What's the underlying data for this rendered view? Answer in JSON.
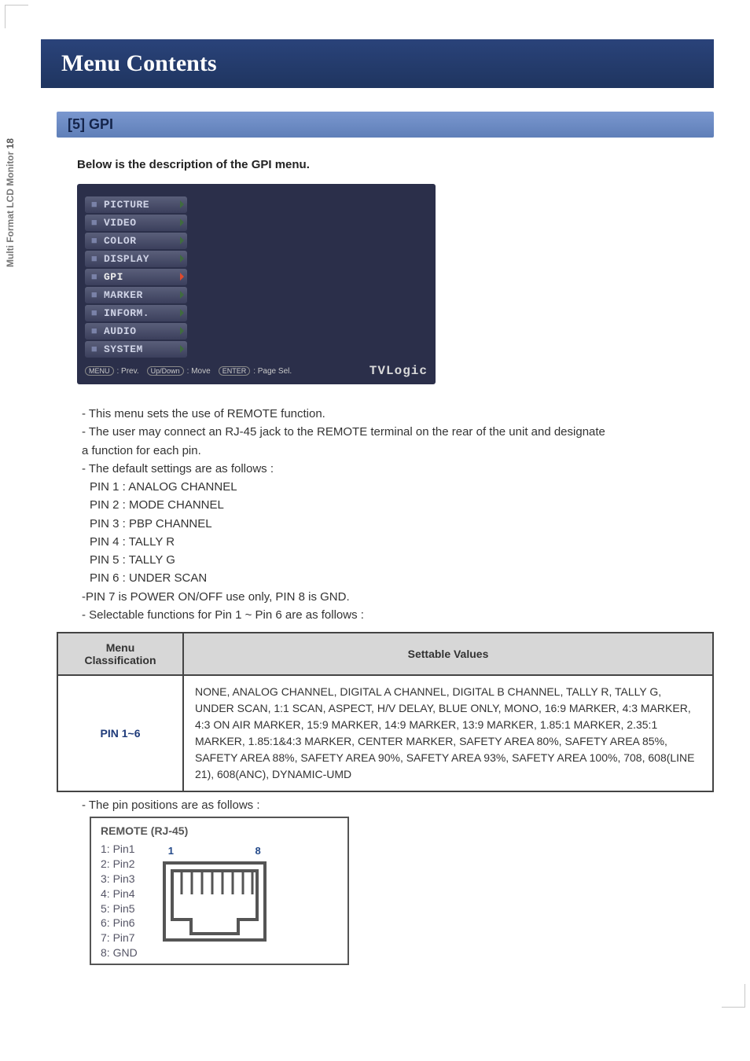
{
  "side_label_prefix": "Multi Format LCD Monitor ",
  "side_label_page": "18",
  "header_title": "Menu Contents",
  "section_header": "[5] GPI",
  "intro": "Below is the description of the GPI menu.",
  "osd": {
    "tabs": [
      {
        "label": "PICTURE",
        "selected": false
      },
      {
        "label": "VIDEO",
        "selected": false
      },
      {
        "label": "COLOR",
        "selected": false
      },
      {
        "label": "DISPLAY",
        "selected": false
      },
      {
        "label": "GPI",
        "selected": true
      },
      {
        "label": "MARKER",
        "selected": false
      },
      {
        "label": "INFORM.",
        "selected": false
      },
      {
        "label": "AUDIO",
        "selected": false
      },
      {
        "label": "SYSTEM",
        "selected": false
      }
    ],
    "hints": {
      "menu_btn": "MENU",
      "menu_txt": ": Prev.",
      "updown_btn": "Up/Down",
      "updown_txt": ": Move",
      "enter_btn": "ENTER",
      "enter_txt": ": Page Sel."
    },
    "logo": "TVLogic"
  },
  "desc_lines": {
    "l1": "- This menu sets the use of REMOTE function.",
    "l2a": "- The user may connect an RJ-45 jack to the REMOTE terminal on the rear of the unit and designate",
    "l2b": "  a function for each pin.",
    "l3": "- The default settings are as follows :",
    "p1": "PIN 1 : ANALOG CHANNEL",
    "p2": "PIN 2 : MODE CHANNEL",
    "p3": "PIN 3 : PBP CHANNEL",
    "p4": "PIN 4 : TALLY R",
    "p5": "PIN 5 : TALLY G",
    "p6": "PIN 6 : UNDER SCAN",
    "l4": "-PIN 7 is POWER ON/OFF use only, PIN 8 is GND.",
    "l5": "- Selectable functions for Pin 1 ~ Pin 6 are as follows :"
  },
  "table": {
    "col1": "Menu Classification",
    "col2": "Settable Values",
    "row_label": "PIN 1~6",
    "row_value": "NONE, ANALOG CHANNEL, DIGITAL A CHANNEL, DIGITAL B CHANNEL, TALLY R, TALLY G, UNDER SCAN, 1:1 SCAN, ASPECT, H/V DELAY, BLUE ONLY, MONO, 16:9 MARKER, 4:3 MARKER, 4:3 ON AIR MARKER, 15:9 MARKER, 14:9 MARKER, 13:9 MARKER, 1.85:1 MARKER, 2.35:1 MARKER, 1.85:1&4:3 MARKER, CENTER MARKER, SAFETY AREA 80%, SAFETY AREA 85%, SAFETY AREA 88%, SAFETY AREA 90%, SAFETY AREA 93%, SAFETY AREA 100%, 708, 608(LINE 21), 608(ANC), DYNAMIC-UMD"
  },
  "pin_pos_line": "- The pin positions are as follows :",
  "remote": {
    "title": "REMOTE (RJ-45)",
    "pins": [
      "1: Pin1",
      "2: Pin2",
      "3: Pin3",
      "4: Pin4",
      "5: Pin5",
      "6: Pin6",
      "7: Pin7",
      "8: GND"
    ],
    "left_num": "1",
    "right_num": "8"
  }
}
